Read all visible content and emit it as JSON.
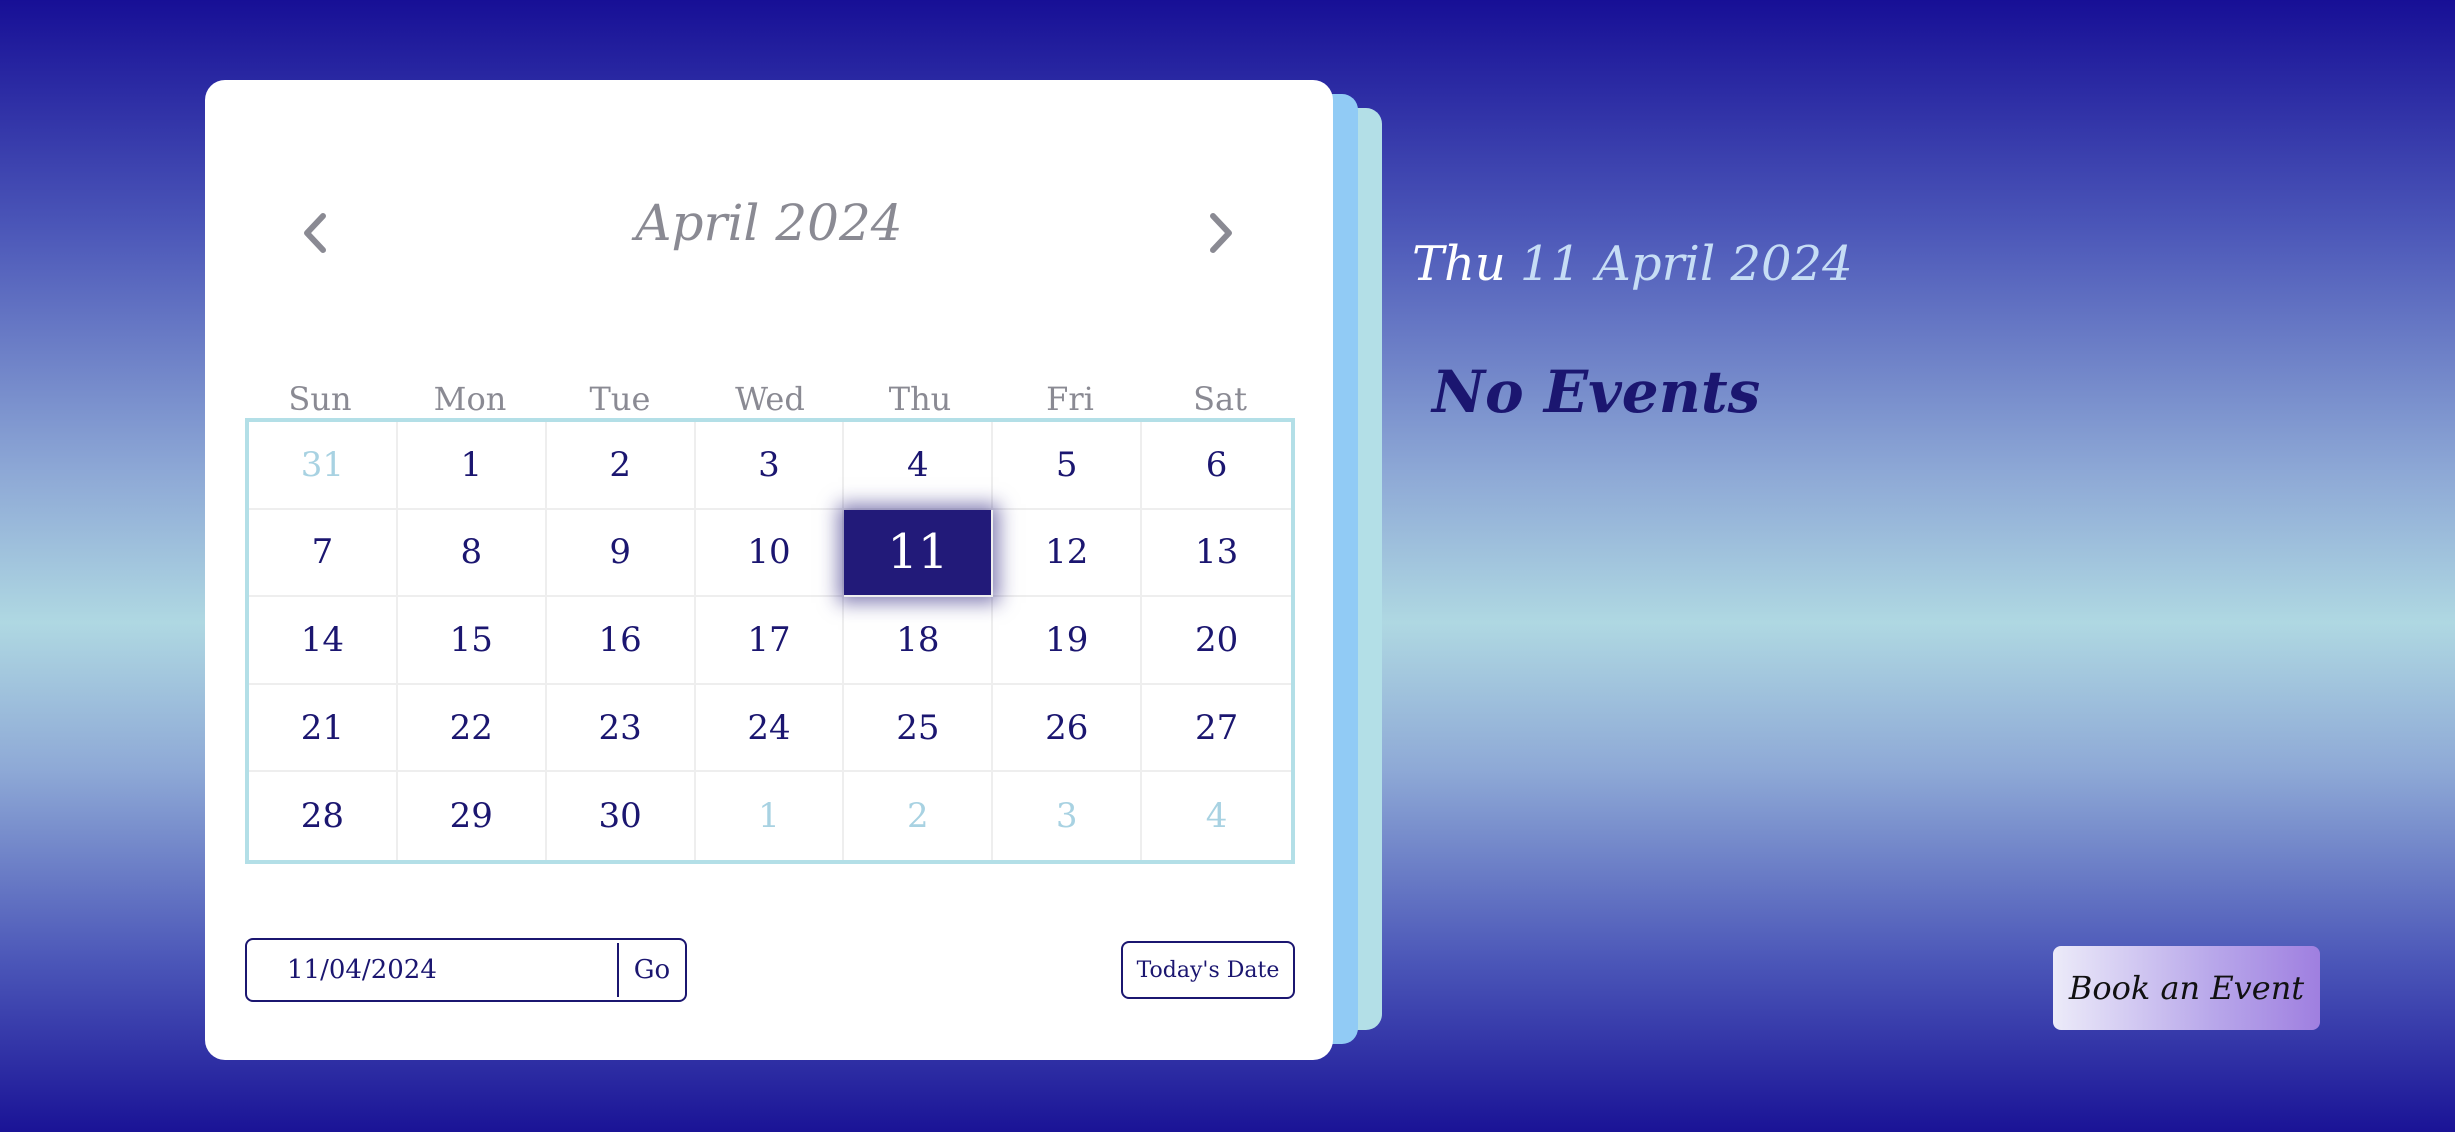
{
  "header": {
    "month_year": "April 2024"
  },
  "nav": {
    "prev_icon": "chevron-left-icon",
    "next_icon": "chevron-right-icon"
  },
  "weekdays": [
    "Sun",
    "Mon",
    "Tue",
    "Wed",
    "Thu",
    "Fri",
    "Sat"
  ],
  "days": [
    {
      "label": "31",
      "muted": true
    },
    {
      "label": "1"
    },
    {
      "label": "2"
    },
    {
      "label": "3"
    },
    {
      "label": "4"
    },
    {
      "label": "5"
    },
    {
      "label": "6"
    },
    {
      "label": "7"
    },
    {
      "label": "8"
    },
    {
      "label": "9"
    },
    {
      "label": "10"
    },
    {
      "label": "11",
      "selected": true
    },
    {
      "label": "12"
    },
    {
      "label": "13"
    },
    {
      "label": "14"
    },
    {
      "label": "15"
    },
    {
      "label": "16"
    },
    {
      "label": "17"
    },
    {
      "label": "18"
    },
    {
      "label": "19"
    },
    {
      "label": "20"
    },
    {
      "label": "21"
    },
    {
      "label": "22"
    },
    {
      "label": "23"
    },
    {
      "label": "24"
    },
    {
      "label": "25"
    },
    {
      "label": "26"
    },
    {
      "label": "27"
    },
    {
      "label": "28"
    },
    {
      "label": "29"
    },
    {
      "label": "30"
    },
    {
      "label": "1",
      "muted": true
    },
    {
      "label": "2",
      "muted": true
    },
    {
      "label": "3",
      "muted": true
    },
    {
      "label": "4",
      "muted": true
    }
  ],
  "date_form": {
    "value": "11/04/2024",
    "go_label": "Go"
  },
  "today_label": "Today's Date",
  "selected": {
    "weekday": "Thu",
    "full_date": "11 April 2024"
  },
  "events": {
    "empty_message": "No Events"
  },
  "book_label": "Book an Event",
  "colors": {
    "primary": "#1b1670",
    "selected_bg": "#221a79",
    "muted_day": "#a8d2e2",
    "grid_border": "#b3dfe7",
    "accent_page": "#91cbf5"
  }
}
